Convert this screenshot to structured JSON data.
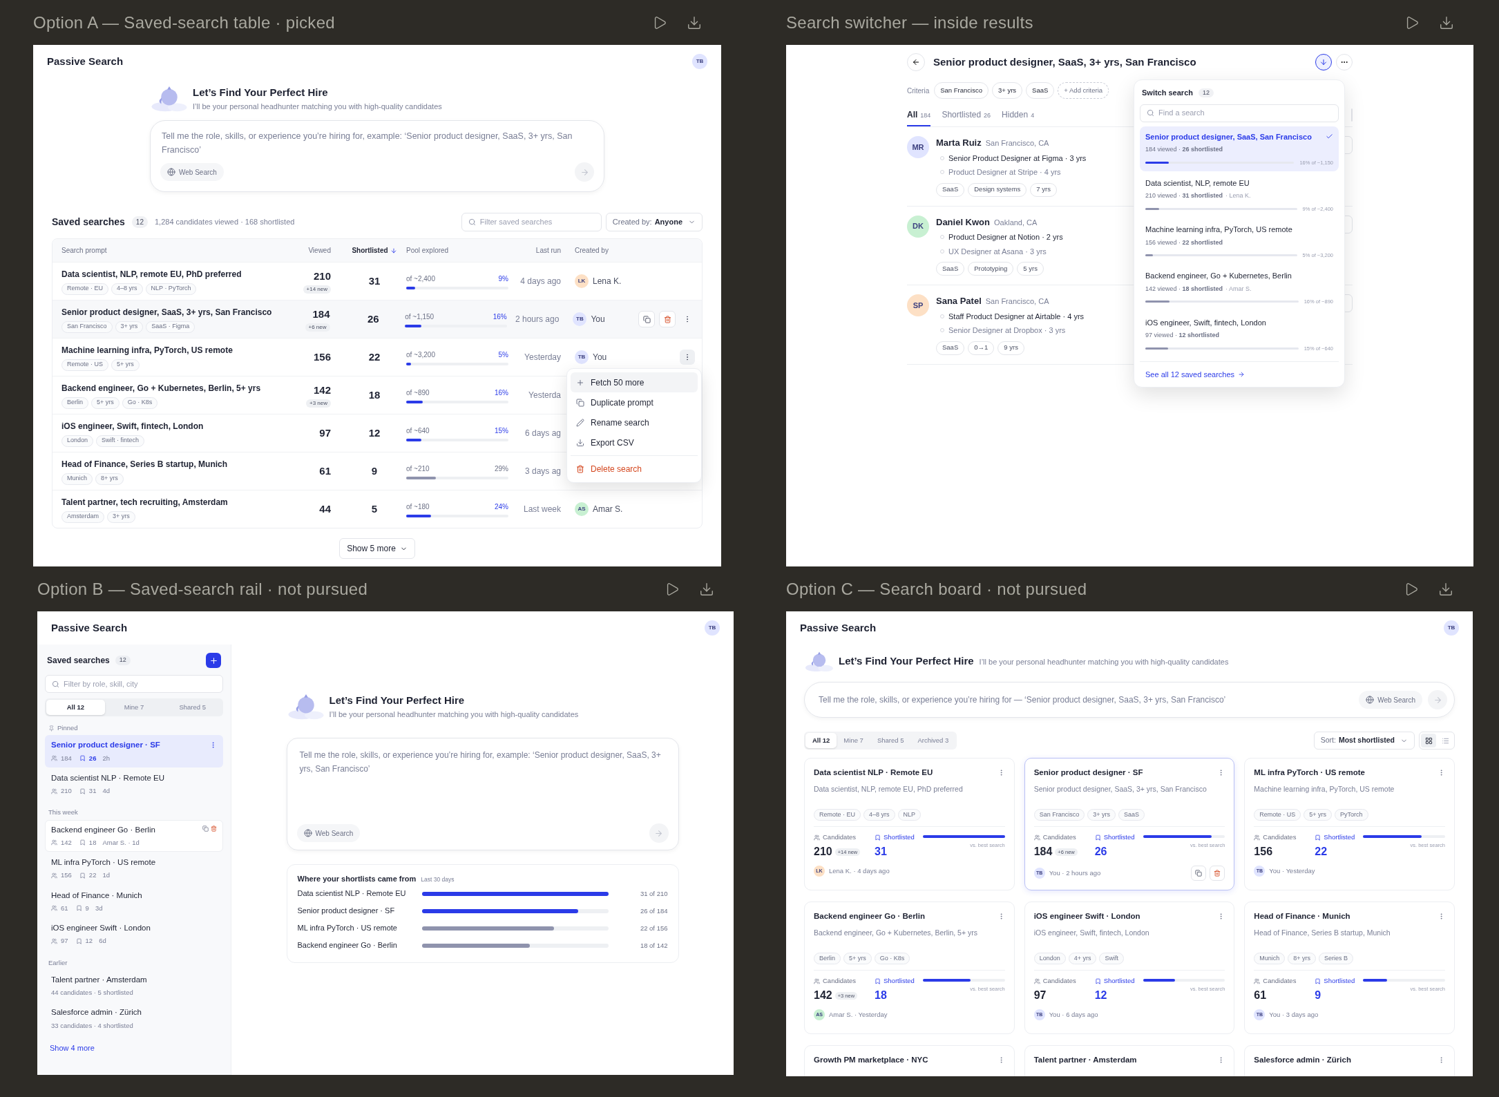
{
  "option_a": {
    "heading": "Option A — Saved-search table · picked",
    "app_title": "Passive Search",
    "user": {
      "initials": "TB",
      "color": "#e0e4ff"
    },
    "hero": {
      "title": "Let’s Find Your Perfect Hire",
      "subtitle": "I’ll be your personal headhunter matching you with high-quality candidates"
    },
    "prompt": {
      "placeholder": "Tell me the role, skills, or experience you’re hiring for, example: ‘Senior product designer, SaaS, 3+ yrs, San Francisco’",
      "web_search": "Web Search"
    },
    "saved": {
      "title": "Saved searches",
      "count": "12",
      "summary": "1,284 candidates viewed · 168 shortlisted",
      "filter_placeholder": "Filter saved searches",
      "created_by_label": "Created by:",
      "created_by_value": "Anyone"
    },
    "columns": [
      {
        "label": "Search prompt",
        "sorted": false
      },
      {
        "label": "Viewed",
        "sorted": false
      },
      {
        "label": "Shortlisted",
        "sorted": true
      },
      {
        "label": "Pool explored",
        "sorted": false
      },
      {
        "label": "Last run",
        "sorted": false
      },
      {
        "label": "Created by",
        "sorted": false
      }
    ],
    "rows": [
      {
        "prompt": "Data scientist, NLP, remote EU, PhD preferred",
        "tags": [
          "Remote · EU",
          "4–8 yrs",
          "NLP · PyTorch"
        ],
        "viewed": "210",
        "new": "+14 new",
        "shortlisted": "31",
        "pool": "of ~2,400",
        "pct": "9%",
        "level": 0.09,
        "muted": false,
        "last_run": "4 days ago",
        "creator": {
          "initials": "LK",
          "name": "Lena K.",
          "color": "#fde0c5"
        },
        "hovered": false,
        "menu_open": false
      },
      {
        "prompt": "Senior product designer, SaaS, 3+ yrs, San Francisco",
        "tags": [
          "San Francisco",
          "3+ yrs",
          "SaaS · Figma"
        ],
        "viewed": "184",
        "new": "+6 new",
        "shortlisted": "26",
        "pool": "of ~1,150",
        "pct": "16%",
        "level": 0.16,
        "muted": false,
        "last_run": "2 hours ago",
        "creator": {
          "initials": "TB",
          "name": "You",
          "color": "#e0e4ff"
        },
        "hovered": true,
        "menu_open": false
      },
      {
        "prompt": "Machine learning infra, PyTorch, US remote",
        "tags": [
          "Remote · US",
          "5+ yrs"
        ],
        "viewed": "156",
        "shortlisted": "22",
        "pool": "of ~3,200",
        "pct": "5%",
        "level": 0.05,
        "muted": false,
        "last_run": "Yesterday",
        "creator": {
          "initials": "TB",
          "name": "You",
          "color": "#e0e4ff"
        },
        "hovered": false,
        "menu_open": true
      },
      {
        "prompt": "Backend engineer, Go + Kubernetes, Berlin, 5+ yrs",
        "tags": [
          "Berlin",
          "5+ yrs",
          "Go · K8s"
        ],
        "viewed": "142",
        "new": "+3 new",
        "shortlisted": "18",
        "pool": "of ~890",
        "pct": "16%",
        "level": 0.16,
        "muted": false,
        "last_run": "Yesterda",
        "hovered": false,
        "menu_open": false
      },
      {
        "prompt": "iOS engineer, Swift, fintech, London",
        "tags": [
          "London",
          "Swift · fintech"
        ],
        "viewed": "97",
        "shortlisted": "12",
        "pool": "of ~640",
        "pct": "15%",
        "level": 0.15,
        "muted": false,
        "last_run": "6 days ag",
        "hovered": false,
        "menu_open": false
      },
      {
        "prompt": "Head of Finance, Series B startup, Munich",
        "tags": [
          "Munich",
          "8+ yrs"
        ],
        "viewed": "61",
        "shortlisted": "9",
        "pool": "of ~210",
        "pct": "29%",
        "level": 0.29,
        "muted": true,
        "last_run": "3 days ag",
        "hovered": false,
        "menu_open": false
      },
      {
        "prompt": "Talent partner, tech recruiting, Amsterdam",
        "tags": [
          "Amsterdam",
          "3+ yrs"
        ],
        "viewed": "44",
        "shortlisted": "5",
        "pool": "of ~180",
        "pct": "24%",
        "level": 0.24,
        "muted": false,
        "last_run": "Last week",
        "creator": {
          "initials": "AS",
          "name": "Amar S.",
          "color": "#c8f0d2"
        },
        "hovered": false,
        "menu_open": false
      }
    ],
    "menu": [
      {
        "label": "Fetch 50 more",
        "kind": "add",
        "selected": true
      },
      {
        "label": "Duplicate prompt",
        "kind": "copy",
        "selected": false
      },
      {
        "label": "Rename search",
        "kind": "rename",
        "selected": false
      },
      {
        "label": "Export CSV",
        "kind": "export",
        "selected": false
      },
      {
        "label": "Delete search",
        "kind": "delete",
        "selected": false
      }
    ],
    "show_more": "Show 5 more"
  },
  "switcher": {
    "heading": "Search switcher — inside results",
    "title": "Senior product designer, SaaS, 3+ yrs, San Francisco",
    "criteria_label": "Criteria",
    "criteria": [
      "San Francisco",
      "3+ yrs",
      "SaaS"
    ],
    "add_criteria": "+ Add criteria",
    "tabs": [
      {
        "label": "All",
        "count": "184",
        "selected": true
      },
      {
        "label": "Shortlisted",
        "count": "26",
        "selected": false
      },
      {
        "label": "Hidden",
        "count": "4",
        "selected": false
      }
    ],
    "candidates": [
      {
        "initials": "MR",
        "color": "#e0e4ff",
        "name": "Marta Ruiz",
        "location": "San Francisco, CA",
        "roles": [
          "Senior Product Designer at Figma · 3 yrs",
          "Product Designer at Stripe · 4 yrs"
        ],
        "tags": [
          "SaaS",
          "Design systems",
          "7 yrs"
        ]
      },
      {
        "initials": "DK",
        "color": "#c8f0d2",
        "name": "Daniel Kwon",
        "location": "Oakland, CA",
        "roles": [
          "Product Designer at Notion · 2 yrs",
          "UX Designer at Asana · 3 yrs"
        ],
        "tags": [
          "SaaS",
          "Prototyping",
          "5 yrs"
        ]
      },
      {
        "initials": "SP",
        "color": "#fde0c5",
        "name": "Sana Patel",
        "location": "San Francisco, CA",
        "roles": [
          "Staff Product Designer at Airtable · 4 yrs",
          "Senior Designer at Dropbox · 3 yrs"
        ],
        "tags": [
          "SaaS",
          "0→1",
          "9 yrs"
        ]
      }
    ],
    "dropdown": {
      "title": "Switch search",
      "count": "12",
      "placeholder": "Find a search",
      "items": [
        {
          "title": "Senior product designer, SaaS, San Francisco",
          "meta": "184 viewed · **26 shortlisted**",
          "pool": "16% of ~1,150",
          "level": 0.16,
          "selected": true
        },
        {
          "title": "Data scientist, NLP, remote EU",
          "meta": "210 viewed · **31 shortlisted**",
          "owner": "· Lena K.",
          "pool": "9% of ~2,400",
          "level": 0.09,
          "selected": false
        },
        {
          "title": "Machine learning infra, PyTorch, US remote",
          "meta": "156 viewed · **22 shortlisted**",
          "pool": "5% of ~3,200",
          "level": 0.05,
          "selected": false
        },
        {
          "title": "Backend engineer, Go + Kubernetes, Berlin",
          "meta": "142 viewed · **18 shortlisted**",
          "owner": "· Amar S.",
          "pool": "16% of ~890",
          "level": 0.16,
          "selected": false
        },
        {
          "title": "iOS engineer, Swift, fintech, London",
          "meta": "97 viewed · **12 shortlisted**",
          "pool": "15% of ~640",
          "level": 0.15,
          "selected": false
        }
      ],
      "see_all": "See all 12 saved searches"
    }
  },
  "option_b": {
    "heading": "Option B — Saved-search rail · not pursued",
    "app_title": "Passive Search",
    "user": {
      "initials": "TB",
      "color": "#e0e4ff"
    },
    "rail": {
      "title": "Saved searches",
      "count": "12",
      "filter_placeholder": "Filter by role, skill, city",
      "tabs": [
        {
          "label": "All 12",
          "selected": true
        },
        {
          "label": "Mine 7",
          "selected": false
        },
        {
          "label": "Shared 5",
          "selected": false
        }
      ],
      "groups": [
        {
          "label": "Pinned",
          "pinned": true,
          "items": [
            {
              "title": "Senior product designer · SF",
              "kind": "stats",
              "viewed": "184",
              "shortlisted": "26",
              "age": "2h",
              "selected": true,
              "hovered": false
            },
            {
              "title": "Data scientist NLP · Remote EU",
              "kind": "stats",
              "viewed": "210",
              "shortlisted": "31",
              "age": "4d",
              "selected": false,
              "hovered": false
            }
          ]
        },
        {
          "label": "This week",
          "pinned": false,
          "items": [
            {
              "title": "Backend engineer Go · Berlin",
              "kind": "stats",
              "viewed": "142",
              "shortlisted": "18",
              "age": "Amar S. · 1d",
              "selected": false,
              "hovered": true
            },
            {
              "title": "ML infra PyTorch · US remote",
              "kind": "stats",
              "viewed": "156",
              "shortlisted": "22",
              "age": "1d",
              "selected": false,
              "hovered": false
            },
            {
              "title": "Head of Finance · Munich",
              "kind": "stats",
              "viewed": "61",
              "shortlisted": "9",
              "age": "3d",
              "selected": false,
              "hovered": false
            },
            {
              "title": "iOS engineer Swift · London",
              "kind": "stats",
              "viewed": "97",
              "shortlisted": "12",
              "age": "6d",
              "selected": false,
              "hovered": false
            }
          ]
        },
        {
          "label": "Earlier",
          "pinned": false,
          "items": [
            {
              "title": "Talent partner · Amsterdam",
              "kind": "summary",
              "summary": "44 candidates · 5 shortlisted",
              "selected": false,
              "hovered": false
            },
            {
              "title": "Salesforce admin · Zürich",
              "kind": "summary",
              "summary": "33 candidates · 4 shortlisted",
              "selected": false,
              "hovered": false
            }
          ]
        }
      ],
      "show_more": "Show 4 more"
    },
    "hero": {
      "title": "Let’s Find Your Perfect Hire",
      "subtitle": "I’ll be your personal headhunter matching you with high-quality candidates"
    },
    "prompt": {
      "placeholder": "Tell me the role, skills, or experience you’re hiring for, example: ‘Senior product designer, SaaS, 3+ yrs, San Francisco’",
      "web_search": "Web Search"
    },
    "sources": {
      "title": "Where your shortlists came from",
      "period": "Last 30 days",
      "rows": [
        {
          "label": "Data scientist NLP · Remote EU",
          "reading": "31 of 210",
          "level": 1.0,
          "muted": false
        },
        {
          "label": "Senior product designer · SF",
          "reading": "26 of 184",
          "level": 0.84,
          "muted": false
        },
        {
          "label": "ML infra PyTorch · US remote",
          "reading": "22 of 156",
          "level": 0.71,
          "muted": true
        },
        {
          "label": "Backend engineer Go · Berlin",
          "reading": "18 of 142",
          "level": 0.58,
          "muted": true
        }
      ]
    }
  },
  "option_c": {
    "heading": "Option C — Search board · not pursued",
    "app_title": "Passive Search",
    "user": {
      "initials": "TB",
      "color": "#e0e4ff"
    },
    "hero": {
      "title": "Let’s Find Your Perfect Hire",
      "subtitle": "I’ll be your personal headhunter matching you with high-quality candidates"
    },
    "prompt": {
      "placeholder": "Tell me the role, skills, or experience you’re hiring for — ‘Senior product designer, SaaS, 3+ yrs, San Francisco’",
      "web_search": "Web Search"
    },
    "filters": [
      {
        "label": "All 12",
        "selected": true
      },
      {
        "label": "Mine 7",
        "selected": false
      },
      {
        "label": "Shared 5",
        "selected": false
      },
      {
        "label": "Archived 3",
        "selected": false
      }
    ],
    "sort_label": "Sort:",
    "sort_value": "Most shortlisted",
    "views": [
      {
        "kind": "grid",
        "selected": true
      },
      {
        "kind": "list",
        "selected": false
      }
    ],
    "cards": [
      {
        "title": "Data scientist NLP · Remote EU",
        "prompt": "Data scientist, NLP, remote EU, PhD preferred",
        "tags": [
          "Remote · EU",
          "4–8 yrs",
          "NLP"
        ],
        "candidates_label": "Candidates",
        "candidates": "210",
        "new": "+14 new",
        "shortlisted_label": "Shortlisted",
        "shortlisted": "31",
        "level": 1.0,
        "compare": "vs. best search",
        "owner": {
          "initials": "LK",
          "color": "#fde0c5"
        },
        "meta": "Lena K. · 4 days ago",
        "selected": false
      },
      {
        "title": "Senior product designer · SF",
        "prompt": "Senior product designer, SaaS, 3+ yrs, San Francisco",
        "tags": [
          "San Francisco",
          "3+ yrs",
          "SaaS"
        ],
        "candidates_label": "Candidates",
        "candidates": "184",
        "new": "+6 new",
        "shortlisted_label": "Shortlisted",
        "shortlisted": "26",
        "level": 0.84,
        "compare": "vs. best search",
        "owner": {
          "initials": "TB",
          "color": "#e0e4ff"
        },
        "meta": "You · 2 hours ago",
        "selected": true
      },
      {
        "title": "ML infra PyTorch · US remote",
        "prompt": "Machine learning infra, PyTorch, US remote",
        "tags": [
          "Remote · US",
          "5+ yrs",
          "PyTorch"
        ],
        "candidates_label": "Candidates",
        "candidates": "156",
        "shortlisted_label": "Shortlisted",
        "shortlisted": "22",
        "level": 0.71,
        "compare": "vs. best search",
        "owner": {
          "initials": "TB",
          "color": "#e0e4ff"
        },
        "meta": "You · Yesterday",
        "selected": false
      },
      {
        "title": "Backend engineer Go · Berlin",
        "prompt": "Backend engineer, Go + Kubernetes, Berlin, 5+ yrs",
        "tags": [
          "Berlin",
          "5+ yrs",
          "Go · K8s"
        ],
        "candidates_label": "Candidates",
        "candidates": "142",
        "new": "+3 new",
        "shortlisted_label": "Shortlisted",
        "shortlisted": "18",
        "level": 0.58,
        "compare": "vs. best search",
        "owner": {
          "initials": "AS",
          "color": "#c8f0d2"
        },
        "meta": "Amar S. · Yesterday",
        "selected": false
      },
      {
        "title": "iOS engineer Swift · London",
        "prompt": "iOS engineer, Swift, fintech, London",
        "tags": [
          "London",
          "4+ yrs",
          "Swift"
        ],
        "candidates_label": "Candidates",
        "candidates": "97",
        "shortlisted_label": "Shortlisted",
        "shortlisted": "12",
        "level": 0.39,
        "compare": "vs. best search",
        "owner": {
          "initials": "TB",
          "color": "#e0e4ff"
        },
        "meta": "You · 6 days ago",
        "selected": false
      },
      {
        "title": "Head of Finance · Munich",
        "prompt": "Head of Finance, Series B startup, Munich",
        "tags": [
          "Munich",
          "8+ yrs",
          "Series B"
        ],
        "candidates_label": "Candidates",
        "candidates": "61",
        "shortlisted_label": "Shortlisted",
        "shortlisted": "9",
        "level": 0.29,
        "compare": "vs. best search",
        "owner": {
          "initials": "TB",
          "color": "#e0e4ff"
        },
        "meta": "You · 3 days ago",
        "selected": false
      },
      {
        "title": "Growth PM marketplace · NYC",
        "selected": false
      },
      {
        "title": "Talent partner · Amsterdam",
        "selected": false
      },
      {
        "title": "Salesforce admin · Zürich",
        "selected": false
      }
    ]
  }
}
